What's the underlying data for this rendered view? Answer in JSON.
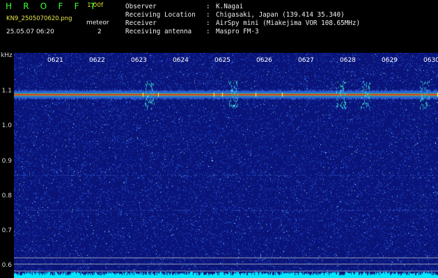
{
  "header": {
    "app_title": "H R O F F T",
    "version": "1.00f",
    "filename": "KN9_2505070620.png",
    "meteor_label": "meteor",
    "meteor_count": "2",
    "datetime": "25.05.07 06:20"
  },
  "station": [
    {
      "key": "Observer",
      "value": "K.Nagai"
    },
    {
      "key": "Receiving Location",
      "value": "Chigasaki, Japan (139.414 35.340)"
    },
    {
      "key": "Receiver",
      "value": "AirSpy mini (Miakejima VOR 108.65MHz)"
    },
    {
      "key": "Receiving antenna",
      "value": "Maspro FM-3"
    }
  ],
  "spectrogram": {
    "unit_label": "kHz",
    "y_ticks": [
      "1.1",
      "1.0",
      "0.9",
      "0.8",
      "0.7",
      "0.6"
    ],
    "y_tick_values": [
      1.1,
      1.0,
      0.9,
      0.8,
      0.7,
      0.6
    ],
    "y_range_khz": [
      0.565,
      1.21
    ],
    "time_ticks": [
      "0621",
      "0622",
      "0623",
      "0624",
      "0625",
      "0626",
      "0627",
      "0628",
      "0629",
      "0630"
    ],
    "time_tick_minutes": [
      21,
      22,
      23,
      24,
      25,
      26,
      27,
      28,
      29,
      30
    ],
    "time_range_minutes": [
      20,
      30.15
    ],
    "carrier_khz": 1.09,
    "background_color": "#0b1478",
    "noise_color": "#2b63d8",
    "carrier_color": "#ff2020",
    "carrier_halo_color": "#30e060",
    "baseline_color": "#00e8ff"
  }
}
